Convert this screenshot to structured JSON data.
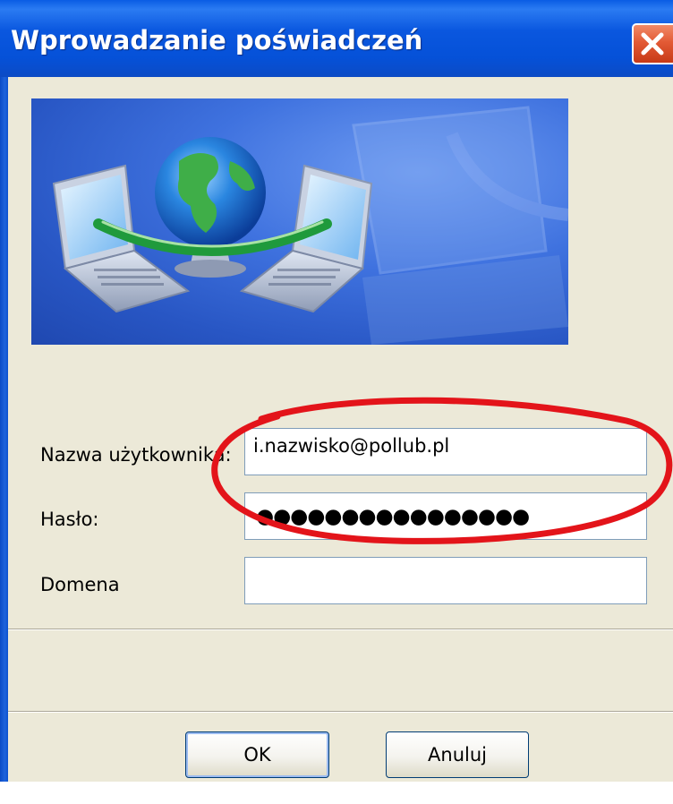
{
  "window": {
    "title": "Wprowadzanie poświadczeń",
    "close_icon": "close-icon"
  },
  "banner": {
    "illustration": "network-globe-laptops-illustration"
  },
  "form": {
    "username_label": "Nazwa użytkownika:",
    "username_value": "i.nazwisko@pollub.pl",
    "password_label": "Hasło:",
    "password_masked": "●●●●●●●●●●●●●●●●",
    "domain_label": "Domena",
    "domain_value": ""
  },
  "buttons": {
    "ok_label": "OK",
    "cancel_label": "Anuluj"
  },
  "annotation": {
    "shape": "red-ellipse-highlight",
    "color": "#e3141a"
  },
  "colors": {
    "titlebar": "#0551d8",
    "dialog_bg": "#ece9d8",
    "field_border": "#7f9db9"
  }
}
